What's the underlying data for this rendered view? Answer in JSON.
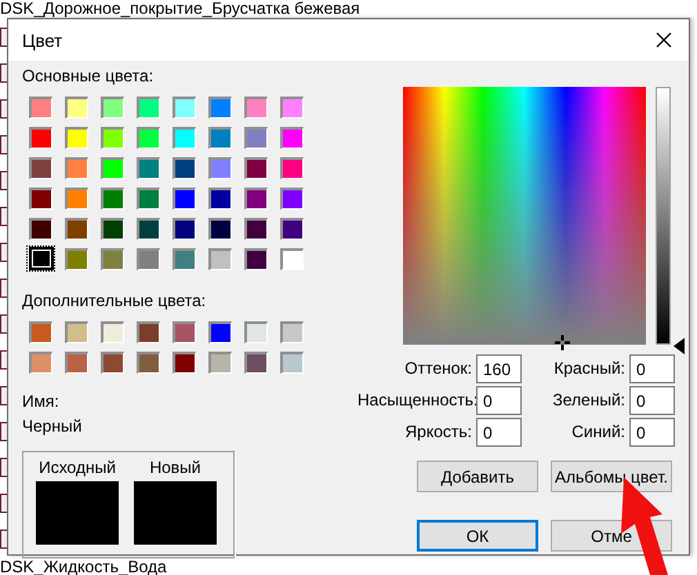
{
  "background_list": [
    {
      "label": "DSK_Дорожное_покрытие_Брусчатка бежевая"
    },
    {
      "label": "DSK_Жидкость_Вода"
    }
  ],
  "window": {
    "title": "Цвет"
  },
  "basic_colors": {
    "label": "Основные цвета:",
    "swatches": [
      {
        "color": "#ff8080",
        "selected": false
      },
      {
        "color": "#ffff80",
        "selected": false
      },
      {
        "color": "#80ff80",
        "selected": false
      },
      {
        "color": "#00ff80",
        "selected": false
      },
      {
        "color": "#80ffff",
        "selected": false
      },
      {
        "color": "#0080ff",
        "selected": false
      },
      {
        "color": "#ff80c0",
        "selected": false
      },
      {
        "color": "#ff80ff",
        "selected": false
      },
      {
        "color": "#ff0000",
        "selected": false
      },
      {
        "color": "#ffff00",
        "selected": false
      },
      {
        "color": "#80ff00",
        "selected": false
      },
      {
        "color": "#00ff40",
        "selected": false
      },
      {
        "color": "#00ffff",
        "selected": false
      },
      {
        "color": "#0080c0",
        "selected": false
      },
      {
        "color": "#8080c0",
        "selected": false
      },
      {
        "color": "#ff00ff",
        "selected": false
      },
      {
        "color": "#804040",
        "selected": false
      },
      {
        "color": "#ff8040",
        "selected": false
      },
      {
        "color": "#00ff00",
        "selected": false
      },
      {
        "color": "#008080",
        "selected": false
      },
      {
        "color": "#004080",
        "selected": false
      },
      {
        "color": "#8080ff",
        "selected": false
      },
      {
        "color": "#800040",
        "selected": false
      },
      {
        "color": "#ff0080",
        "selected": false
      },
      {
        "color": "#800000",
        "selected": false
      },
      {
        "color": "#ff8000",
        "selected": false
      },
      {
        "color": "#008000",
        "selected": false
      },
      {
        "color": "#008040",
        "selected": false
      },
      {
        "color": "#0000ff",
        "selected": false
      },
      {
        "color": "#0000a0",
        "selected": false
      },
      {
        "color": "#800080",
        "selected": false
      },
      {
        "color": "#8000ff",
        "selected": false
      },
      {
        "color": "#400000",
        "selected": false
      },
      {
        "color": "#804000",
        "selected": false
      },
      {
        "color": "#004000",
        "selected": false
      },
      {
        "color": "#004040",
        "selected": false
      },
      {
        "color": "#000080",
        "selected": false
      },
      {
        "color": "#000040",
        "selected": false
      },
      {
        "color": "#400040",
        "selected": false
      },
      {
        "color": "#400080",
        "selected": false
      },
      {
        "color": "#000000",
        "selected": true
      },
      {
        "color": "#808000",
        "selected": false
      },
      {
        "color": "#808040",
        "selected": false
      },
      {
        "color": "#808080",
        "selected": false
      },
      {
        "color": "#408080",
        "selected": false
      },
      {
        "color": "#c0c0c0",
        "selected": false
      },
      {
        "color": "#400040",
        "selected": false
      },
      {
        "color": "#ffffff",
        "selected": false
      }
    ]
  },
  "custom_colors": {
    "label": "Дополнительные цвета:",
    "swatches": [
      {
        "color": "#c85a1e"
      },
      {
        "color": "#d2be8c"
      },
      {
        "color": "#f0ecdc"
      },
      {
        "color": "#7a3e2a"
      },
      {
        "color": "#a85462"
      },
      {
        "color": "#0000ff"
      },
      {
        "color": "#e0e6e8"
      },
      {
        "color": "#c8c8c8"
      },
      {
        "color": "#dc9068"
      },
      {
        "color": "#b86246"
      },
      {
        "color": "#8c4a32"
      },
      {
        "color": "#825e40"
      },
      {
        "color": "#800000"
      },
      {
        "color": "#b8b4aa"
      },
      {
        "color": "#6e4e60"
      },
      {
        "color": "#b8c8cc"
      }
    ]
  },
  "name": {
    "label": "Имя:",
    "value": "Черный"
  },
  "preview": [
    {
      "label": "Исходный",
      "color": "#000000"
    },
    {
      "label": "Новый",
      "color": "#000000"
    }
  ],
  "luminance_slider": {
    "level": 0
  },
  "fields": [
    {
      "label": "Оттенок:",
      "value": "160"
    },
    {
      "label": "Красный:",
      "value": "0"
    },
    {
      "label": "Насыщенность:",
      "value": "0"
    },
    {
      "label": "Зеленый:",
      "value": "0"
    },
    {
      "label": "Яркость:",
      "value": "0"
    },
    {
      "label": "Синий:",
      "value": "0"
    }
  ],
  "buttons": [
    {
      "label": "Добавить",
      "focused": false
    },
    {
      "label": "Альбомы цвет.",
      "focused": false
    },
    {
      "label": "ОК",
      "focused": true
    },
    {
      "label": "Отме",
      "focused": false
    }
  ]
}
